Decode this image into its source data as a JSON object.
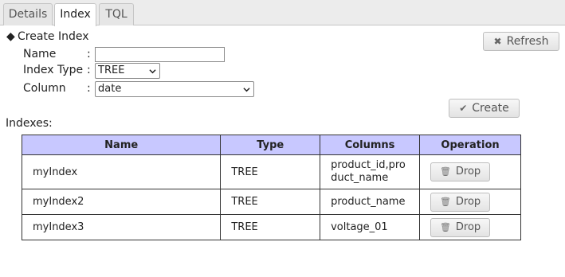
{
  "tabs": [
    {
      "label": "Details",
      "active": false
    },
    {
      "label": "Index",
      "active": true
    },
    {
      "label": "TQL",
      "active": false
    }
  ],
  "create_section": {
    "title": "Create Index",
    "marker": "◆",
    "name_label": "Name",
    "name_value": "",
    "type_label": "Index Type",
    "type_value": "TREE",
    "column_label": "Column",
    "column_value": "date",
    "colon": ":",
    "create_button": "Create"
  },
  "refresh_button": "Refresh",
  "indexes_label": "Indexes:",
  "table": {
    "headers": [
      "Name",
      "Type",
      "Columns",
      "Operation"
    ],
    "rows": [
      {
        "name": "myIndex",
        "type": "TREE",
        "columns": "product_id,product_name",
        "operation": "Drop"
      },
      {
        "name": "myIndex2",
        "type": "TREE",
        "columns": "product_name",
        "operation": "Drop"
      },
      {
        "name": "myIndex3",
        "type": "TREE",
        "columns": "voltage_01",
        "operation": "Drop"
      }
    ]
  },
  "icons": {
    "refresh": "close-x-icon",
    "create": "checkmark-icon",
    "drop": "trash-icon",
    "select": "chevron-down-icon"
  }
}
